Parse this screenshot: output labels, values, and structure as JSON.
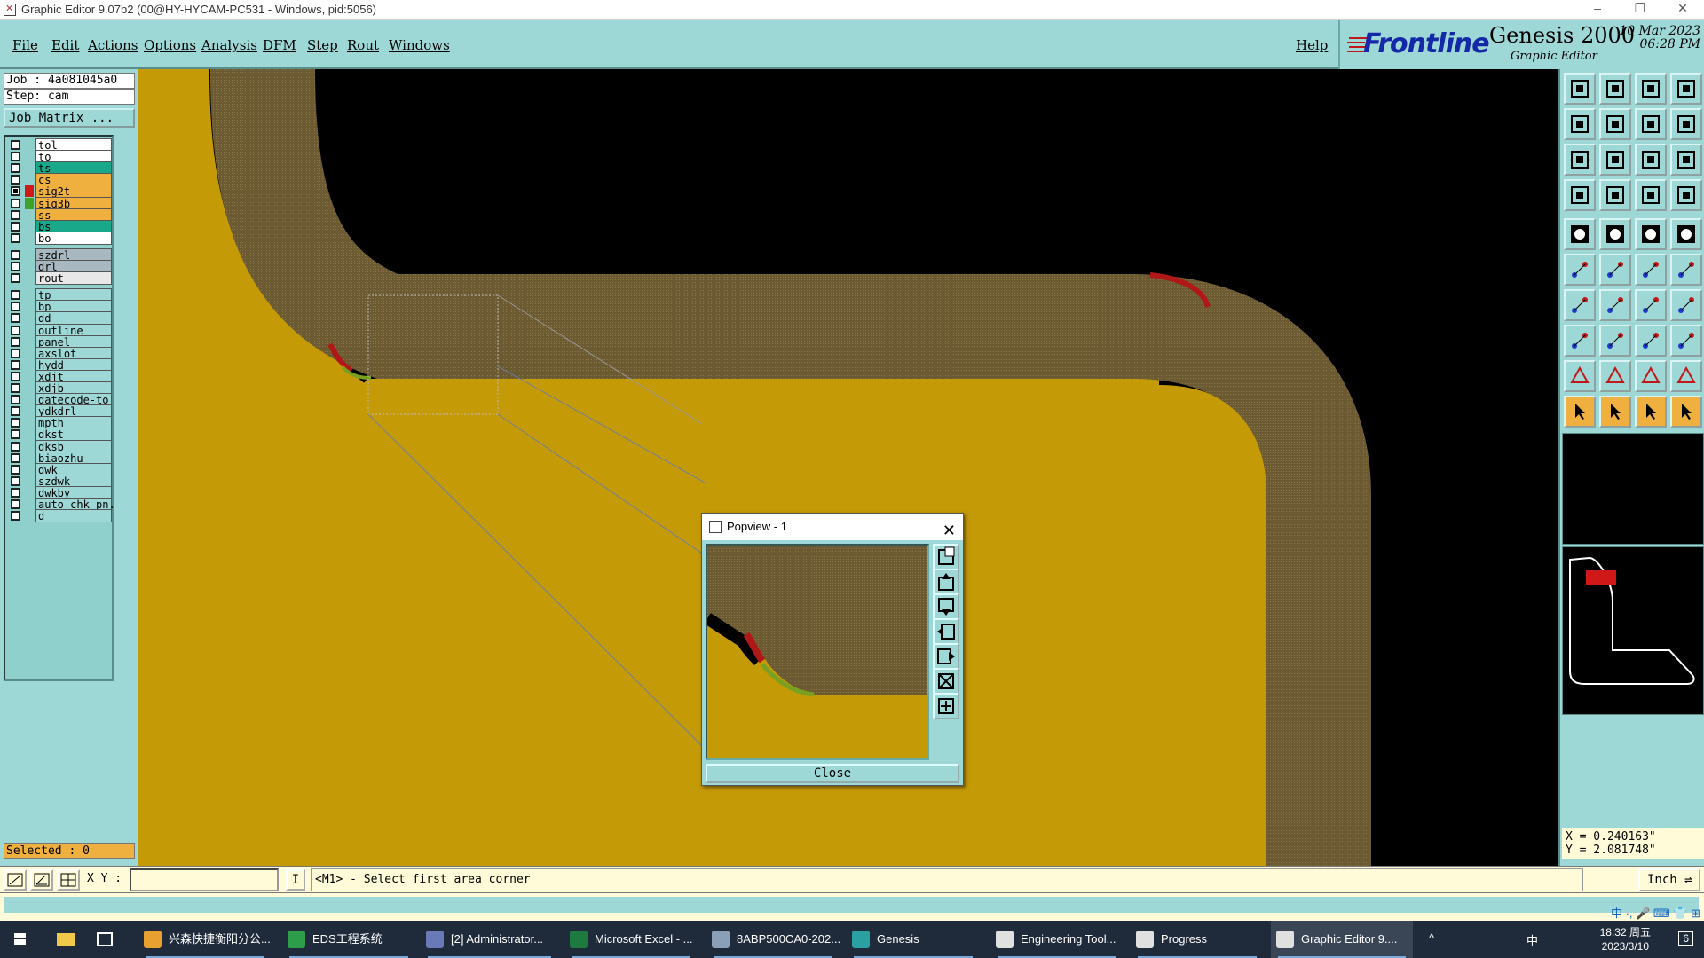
{
  "window": {
    "title": "Graphic Editor 9.07b2 (00@HY-HYCAM-PC531 - Windows, pid:5056)",
    "controls": [
      "–",
      "❐",
      "✕"
    ]
  },
  "menu": [
    "File",
    "Edit",
    "Actions",
    "Options",
    "Analysis",
    "DFM",
    "Step",
    "Rout",
    "Windows"
  ],
  "help_label": "Help",
  "brand": {
    "logo": "Frontline",
    "product": "Genesis 2000",
    "subtitle": "Graphic Editor",
    "date": "10 Mar 2023",
    "time": "06:28 PM"
  },
  "job": {
    "job_line": "Job : 4a081045a0",
    "step_line": "Step: cam",
    "job_matrix_label": "Job Matrix ..."
  },
  "layers": [
    {
      "name": "tol",
      "color": "#ffffff",
      "bg": "#ffffff",
      "checked": false
    },
    {
      "name": "to",
      "color": "#ffffff",
      "bg": "#ffffff",
      "checked": false
    },
    {
      "name": "ts",
      "color": "#ffffff",
      "bg": "#19a88a",
      "checked": false
    },
    {
      "name": "cs",
      "color": "#ffffff",
      "bg": "#f0b040",
      "checked": false
    },
    {
      "name": "sig2t",
      "color": "#d01818",
      "bg": "#f0b040",
      "checked": true
    },
    {
      "name": "sig3b",
      "color": "#3fa02a",
      "bg": "#f0b040",
      "checked": false
    },
    {
      "name": "ss",
      "color": "#ffffff",
      "bg": "#f0b040",
      "checked": false
    },
    {
      "name": "bs",
      "color": "#ffffff",
      "bg": "#19a88a",
      "checked": false
    },
    {
      "name": "bo",
      "color": "#ffffff",
      "bg": "#ffffff",
      "checked": false
    },
    {
      "name": "szdrl",
      "color": "#ffffff",
      "bg": "#a8b8c0",
      "checked": false
    },
    {
      "name": "drl",
      "color": "#ffffff",
      "bg": "#a8b8c0",
      "checked": false
    },
    {
      "name": "rout",
      "color": "#ffffff",
      "bg": "#e8e8e8",
      "checked": false
    },
    {
      "name": "tp",
      "color": "#ffffff",
      "bg": "#9ed8d6",
      "checked": false
    },
    {
      "name": "bp",
      "color": "#ffffff",
      "bg": "#9ed8d6",
      "checked": false
    },
    {
      "name": "dd",
      "color": "#ffffff",
      "bg": "#9ed8d6",
      "checked": false
    },
    {
      "name": "outline",
      "color": "#ffffff",
      "bg": "#9ed8d6",
      "checked": false
    },
    {
      "name": "panel",
      "color": "#ffffff",
      "bg": "#9ed8d6",
      "checked": false
    },
    {
      "name": "axslot",
      "color": "#ffffff",
      "bg": "#9ed8d6",
      "checked": false
    },
    {
      "name": "hydd",
      "color": "#ffffff",
      "bg": "#9ed8d6",
      "checked": false
    },
    {
      "name": "xdjt",
      "color": "#ffffff",
      "bg": "#9ed8d6",
      "checked": false
    },
    {
      "name": "xdjb",
      "color": "#ffffff",
      "bg": "#9ed8d6",
      "checked": false
    },
    {
      "name": "datecode-to",
      "color": "#ffffff",
      "bg": "#9ed8d6",
      "checked": false
    },
    {
      "name": "ydkdrl",
      "color": "#ffffff",
      "bg": "#9ed8d6",
      "checked": false
    },
    {
      "name": "mpth",
      "color": "#ffffff",
      "bg": "#9ed8d6",
      "checked": false
    },
    {
      "name": "dkst",
      "color": "#ffffff",
      "bg": "#9ed8d6",
      "checked": false
    },
    {
      "name": "dksb",
      "color": "#ffffff",
      "bg": "#9ed8d6",
      "checked": false
    },
    {
      "name": "biaozhu",
      "color": "#ffffff",
      "bg": "#9ed8d6",
      "checked": false
    },
    {
      "name": "dwk",
      "color": "#ffffff",
      "bg": "#9ed8d6",
      "checked": false
    },
    {
      "name": "szdwk",
      "color": "#ffffff",
      "bg": "#9ed8d6",
      "checked": false
    },
    {
      "name": "dwkby",
      "color": "#ffffff",
      "bg": "#9ed8d6",
      "checked": false
    },
    {
      "name": "auto_chk_pn.",
      "color": "#ffffff",
      "bg": "#9ed8d6",
      "checked": false
    },
    {
      "name": "d",
      "color": "#ffffff",
      "bg": "#9ed8d6",
      "checked": false
    }
  ],
  "selected_label": "Selected : 0",
  "coords": {
    "x": "X = 0.240163\"",
    "y": "Y = 2.081748\""
  },
  "command": {
    "xy_label": "X Y :",
    "xy_value": "",
    "prompt": "<M1> - Select first area corner",
    "unit": "Inch"
  },
  "popview": {
    "title": "Popview - 1",
    "close_label": "Close"
  },
  "taskbar": {
    "items": [
      {
        "label": "兴森快捷衡阳分公...",
        "icon_color": "#e8a030"
      },
      {
        "label": "EDS工程系统",
        "icon_color": "#2e9d4a"
      },
      {
        "label": "[2] Administrator...",
        "icon_color": "#6a7ab8"
      },
      {
        "label": "Microsoft Excel - ...",
        "icon_color": "#1e7a3e"
      },
      {
        "label": "8ABP500CA0-202...",
        "icon_color": "#8aa0b8"
      },
      {
        "label": "Genesis",
        "icon_color": "#2aa0a0"
      },
      {
        "label": "Engineering Tool...",
        "icon_color": "#e0e0e0"
      },
      {
        "label": "Progress",
        "icon_color": "#e0e0e0"
      },
      {
        "label": "Graphic Editor 9....",
        "icon_color": "#e0e0e0"
      }
    ],
    "clock_time": "18:32 周五",
    "clock_date": "2023/3/10",
    "tray_ime": "中",
    "notification_count": "6"
  },
  "ime_bar": "中 ·, 🎤 ⌨ 👕 ⊞"
}
